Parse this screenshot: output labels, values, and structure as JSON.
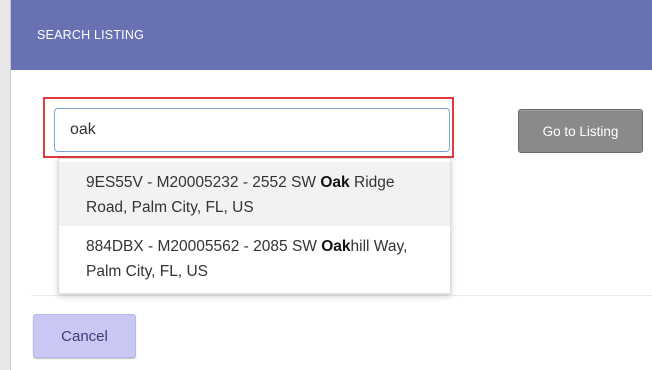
{
  "dialog": {
    "title": "SEARCH LISTING"
  },
  "search": {
    "value": "oak",
    "go_button_label": "Go to Listing"
  },
  "suggestions": [
    {
      "before": "9ES55V - M20005232 - 2552 SW ",
      "match": "Oak",
      "after": " Ridge Road, Palm City, FL, US"
    },
    {
      "before": "884DBX - M20005562 - 2085 SW ",
      "match": "Oak",
      "after": "hill Way, Palm City, FL, US"
    }
  ],
  "footer": {
    "cancel_label": "Cancel"
  },
  "colors": {
    "header": "#6872b3",
    "highlight_border": "#e03b3b",
    "go_button": "#8a8a8a",
    "cancel_button": "#c9c7f4"
  }
}
